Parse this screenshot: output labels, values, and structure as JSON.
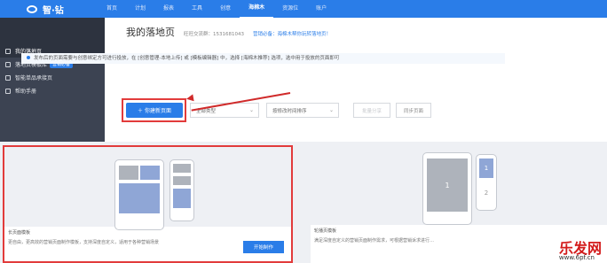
{
  "brand": {
    "name": "智·钻"
  },
  "nav": [
    "首页",
    "计划",
    "报表",
    "工具",
    "创意",
    "海棉木",
    "资源位",
    "账户"
  ],
  "sidebar": {
    "items": [
      {
        "label": "我的落地页"
      },
      {
        "label": "落地页模板库",
        "badge": "营销必备"
      },
      {
        "label": "智能单品承接页"
      },
      {
        "label": "帮助手册"
      }
    ]
  },
  "page": {
    "title": "我的落地页",
    "qq_group": "旺旺交流群：1531681043",
    "promo_link": "营销必备：海棉木帮你玩转落地页！",
    "tip": "发布后的页面需要与创意绑定方可进行投放，在 [创意管理-本地上传] 或 [模板编辑器] 中，选择 [海棉木推荐] 选项，选中用于投放的页面即可"
  },
  "toolbar": {
    "new_page": "＋ 你建新页面",
    "filter_type": "全部类型",
    "sort": "按修改时间排序",
    "batch": "批量分享",
    "sync": "同步页面"
  },
  "templates": [
    {
      "name": "长页面模板",
      "desc": "更自由，更高效的营销页面制作模板，支持深度自定义，适用于各种营销场景",
      "button": "开始制作"
    },
    {
      "name": "轮播页模板",
      "desc": "满足深度自定义的营销页面制作需求，可根据营销诉求进行…"
    }
  ],
  "carousel_labels": [
    "1",
    "1",
    "2"
  ],
  "watermark": {
    "text": "乐发网",
    "url": "www.6pf.cn"
  },
  "colors": {
    "accent": "#2a7de8",
    "highlight": "#e23b3b",
    "sidebar": "#3c4352"
  }
}
